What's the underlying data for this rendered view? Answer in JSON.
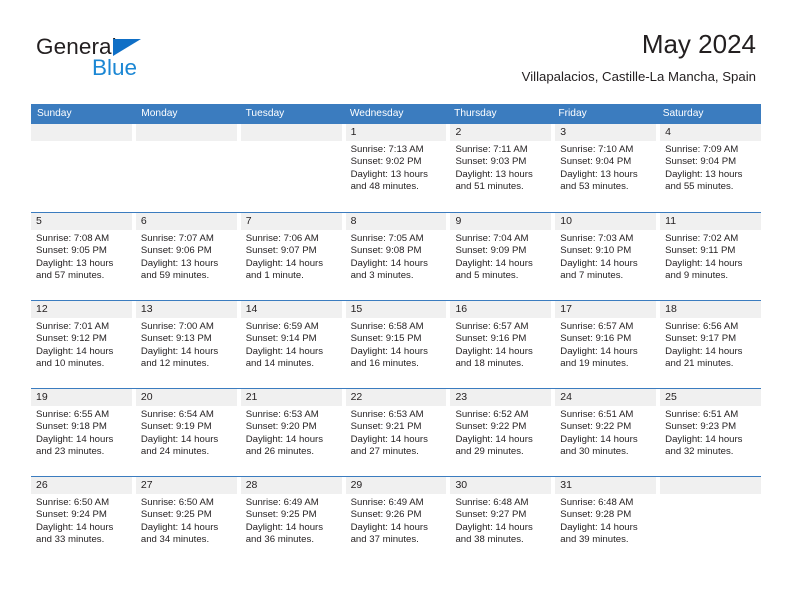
{
  "brand": {
    "name_part1": "General",
    "name_part2": "Blue",
    "triangle_icon": "triangle-icon",
    "color_dark": "#231f20",
    "color_blue": "#1b87d4"
  },
  "header": {
    "title": "May 2024",
    "subtitle": "Villapalacios, Castille-La Mancha, Spain"
  },
  "theme": {
    "header_blue": "#3b7cbf",
    "daynum_band": "#f0f0f0",
    "text": "#231f20"
  },
  "calendar": {
    "weekday_headers": [
      "Sunday",
      "Monday",
      "Tuesday",
      "Wednesday",
      "Thursday",
      "Friday",
      "Saturday"
    ],
    "weeks": [
      [
        {
          "day": "",
          "empty": true
        },
        {
          "day": "",
          "empty": true
        },
        {
          "day": "",
          "empty": true
        },
        {
          "day": "1",
          "sunrise": "Sunrise: 7:13 AM",
          "sunset": "Sunset: 9:02 PM",
          "daylight1": "Daylight: 13 hours",
          "daylight2": "and 48 minutes."
        },
        {
          "day": "2",
          "sunrise": "Sunrise: 7:11 AM",
          "sunset": "Sunset: 9:03 PM",
          "daylight1": "Daylight: 13 hours",
          "daylight2": "and 51 minutes."
        },
        {
          "day": "3",
          "sunrise": "Sunrise: 7:10 AM",
          "sunset": "Sunset: 9:04 PM",
          "daylight1": "Daylight: 13 hours",
          "daylight2": "and 53 minutes."
        },
        {
          "day": "4",
          "sunrise": "Sunrise: 7:09 AM",
          "sunset": "Sunset: 9:04 PM",
          "daylight1": "Daylight: 13 hours",
          "daylight2": "and 55 minutes."
        }
      ],
      [
        {
          "day": "5",
          "sunrise": "Sunrise: 7:08 AM",
          "sunset": "Sunset: 9:05 PM",
          "daylight1": "Daylight: 13 hours",
          "daylight2": "and 57 minutes."
        },
        {
          "day": "6",
          "sunrise": "Sunrise: 7:07 AM",
          "sunset": "Sunset: 9:06 PM",
          "daylight1": "Daylight: 13 hours",
          "daylight2": "and 59 minutes."
        },
        {
          "day": "7",
          "sunrise": "Sunrise: 7:06 AM",
          "sunset": "Sunset: 9:07 PM",
          "daylight1": "Daylight: 14 hours",
          "daylight2": "and 1 minute."
        },
        {
          "day": "8",
          "sunrise": "Sunrise: 7:05 AM",
          "sunset": "Sunset: 9:08 PM",
          "daylight1": "Daylight: 14 hours",
          "daylight2": "and 3 minutes."
        },
        {
          "day": "9",
          "sunrise": "Sunrise: 7:04 AM",
          "sunset": "Sunset: 9:09 PM",
          "daylight1": "Daylight: 14 hours",
          "daylight2": "and 5 minutes."
        },
        {
          "day": "10",
          "sunrise": "Sunrise: 7:03 AM",
          "sunset": "Sunset: 9:10 PM",
          "daylight1": "Daylight: 14 hours",
          "daylight2": "and 7 minutes."
        },
        {
          "day": "11",
          "sunrise": "Sunrise: 7:02 AM",
          "sunset": "Sunset: 9:11 PM",
          "daylight1": "Daylight: 14 hours",
          "daylight2": "and 9 minutes."
        }
      ],
      [
        {
          "day": "12",
          "sunrise": "Sunrise: 7:01 AM",
          "sunset": "Sunset: 9:12 PM",
          "daylight1": "Daylight: 14 hours",
          "daylight2": "and 10 minutes."
        },
        {
          "day": "13",
          "sunrise": "Sunrise: 7:00 AM",
          "sunset": "Sunset: 9:13 PM",
          "daylight1": "Daylight: 14 hours",
          "daylight2": "and 12 minutes."
        },
        {
          "day": "14",
          "sunrise": "Sunrise: 6:59 AM",
          "sunset": "Sunset: 9:14 PM",
          "daylight1": "Daylight: 14 hours",
          "daylight2": "and 14 minutes."
        },
        {
          "day": "15",
          "sunrise": "Sunrise: 6:58 AM",
          "sunset": "Sunset: 9:15 PM",
          "daylight1": "Daylight: 14 hours",
          "daylight2": "and 16 minutes."
        },
        {
          "day": "16",
          "sunrise": "Sunrise: 6:57 AM",
          "sunset": "Sunset: 9:16 PM",
          "daylight1": "Daylight: 14 hours",
          "daylight2": "and 18 minutes."
        },
        {
          "day": "17",
          "sunrise": "Sunrise: 6:57 AM",
          "sunset": "Sunset: 9:16 PM",
          "daylight1": "Daylight: 14 hours",
          "daylight2": "and 19 minutes."
        },
        {
          "day": "18",
          "sunrise": "Sunrise: 6:56 AM",
          "sunset": "Sunset: 9:17 PM",
          "daylight1": "Daylight: 14 hours",
          "daylight2": "and 21 minutes."
        }
      ],
      [
        {
          "day": "19",
          "sunrise": "Sunrise: 6:55 AM",
          "sunset": "Sunset: 9:18 PM",
          "daylight1": "Daylight: 14 hours",
          "daylight2": "and 23 minutes."
        },
        {
          "day": "20",
          "sunrise": "Sunrise: 6:54 AM",
          "sunset": "Sunset: 9:19 PM",
          "daylight1": "Daylight: 14 hours",
          "daylight2": "and 24 minutes."
        },
        {
          "day": "21",
          "sunrise": "Sunrise: 6:53 AM",
          "sunset": "Sunset: 9:20 PM",
          "daylight1": "Daylight: 14 hours",
          "daylight2": "and 26 minutes."
        },
        {
          "day": "22",
          "sunrise": "Sunrise: 6:53 AM",
          "sunset": "Sunset: 9:21 PM",
          "daylight1": "Daylight: 14 hours",
          "daylight2": "and 27 minutes."
        },
        {
          "day": "23",
          "sunrise": "Sunrise: 6:52 AM",
          "sunset": "Sunset: 9:22 PM",
          "daylight1": "Daylight: 14 hours",
          "daylight2": "and 29 minutes."
        },
        {
          "day": "24",
          "sunrise": "Sunrise: 6:51 AM",
          "sunset": "Sunset: 9:22 PM",
          "daylight1": "Daylight: 14 hours",
          "daylight2": "and 30 minutes."
        },
        {
          "day": "25",
          "sunrise": "Sunrise: 6:51 AM",
          "sunset": "Sunset: 9:23 PM",
          "daylight1": "Daylight: 14 hours",
          "daylight2": "and 32 minutes."
        }
      ],
      [
        {
          "day": "26",
          "sunrise": "Sunrise: 6:50 AM",
          "sunset": "Sunset: 9:24 PM",
          "daylight1": "Daylight: 14 hours",
          "daylight2": "and 33 minutes."
        },
        {
          "day": "27",
          "sunrise": "Sunrise: 6:50 AM",
          "sunset": "Sunset: 9:25 PM",
          "daylight1": "Daylight: 14 hours",
          "daylight2": "and 34 minutes."
        },
        {
          "day": "28",
          "sunrise": "Sunrise: 6:49 AM",
          "sunset": "Sunset: 9:25 PM",
          "daylight1": "Daylight: 14 hours",
          "daylight2": "and 36 minutes."
        },
        {
          "day": "29",
          "sunrise": "Sunrise: 6:49 AM",
          "sunset": "Sunset: 9:26 PM",
          "daylight1": "Daylight: 14 hours",
          "daylight2": "and 37 minutes."
        },
        {
          "day": "30",
          "sunrise": "Sunrise: 6:48 AM",
          "sunset": "Sunset: 9:27 PM",
          "daylight1": "Daylight: 14 hours",
          "daylight2": "and 38 minutes."
        },
        {
          "day": "31",
          "sunrise": "Sunrise: 6:48 AM",
          "sunset": "Sunset: 9:28 PM",
          "daylight1": "Daylight: 14 hours",
          "daylight2": "and 39 minutes."
        },
        {
          "day": "",
          "empty": true
        }
      ]
    ]
  }
}
